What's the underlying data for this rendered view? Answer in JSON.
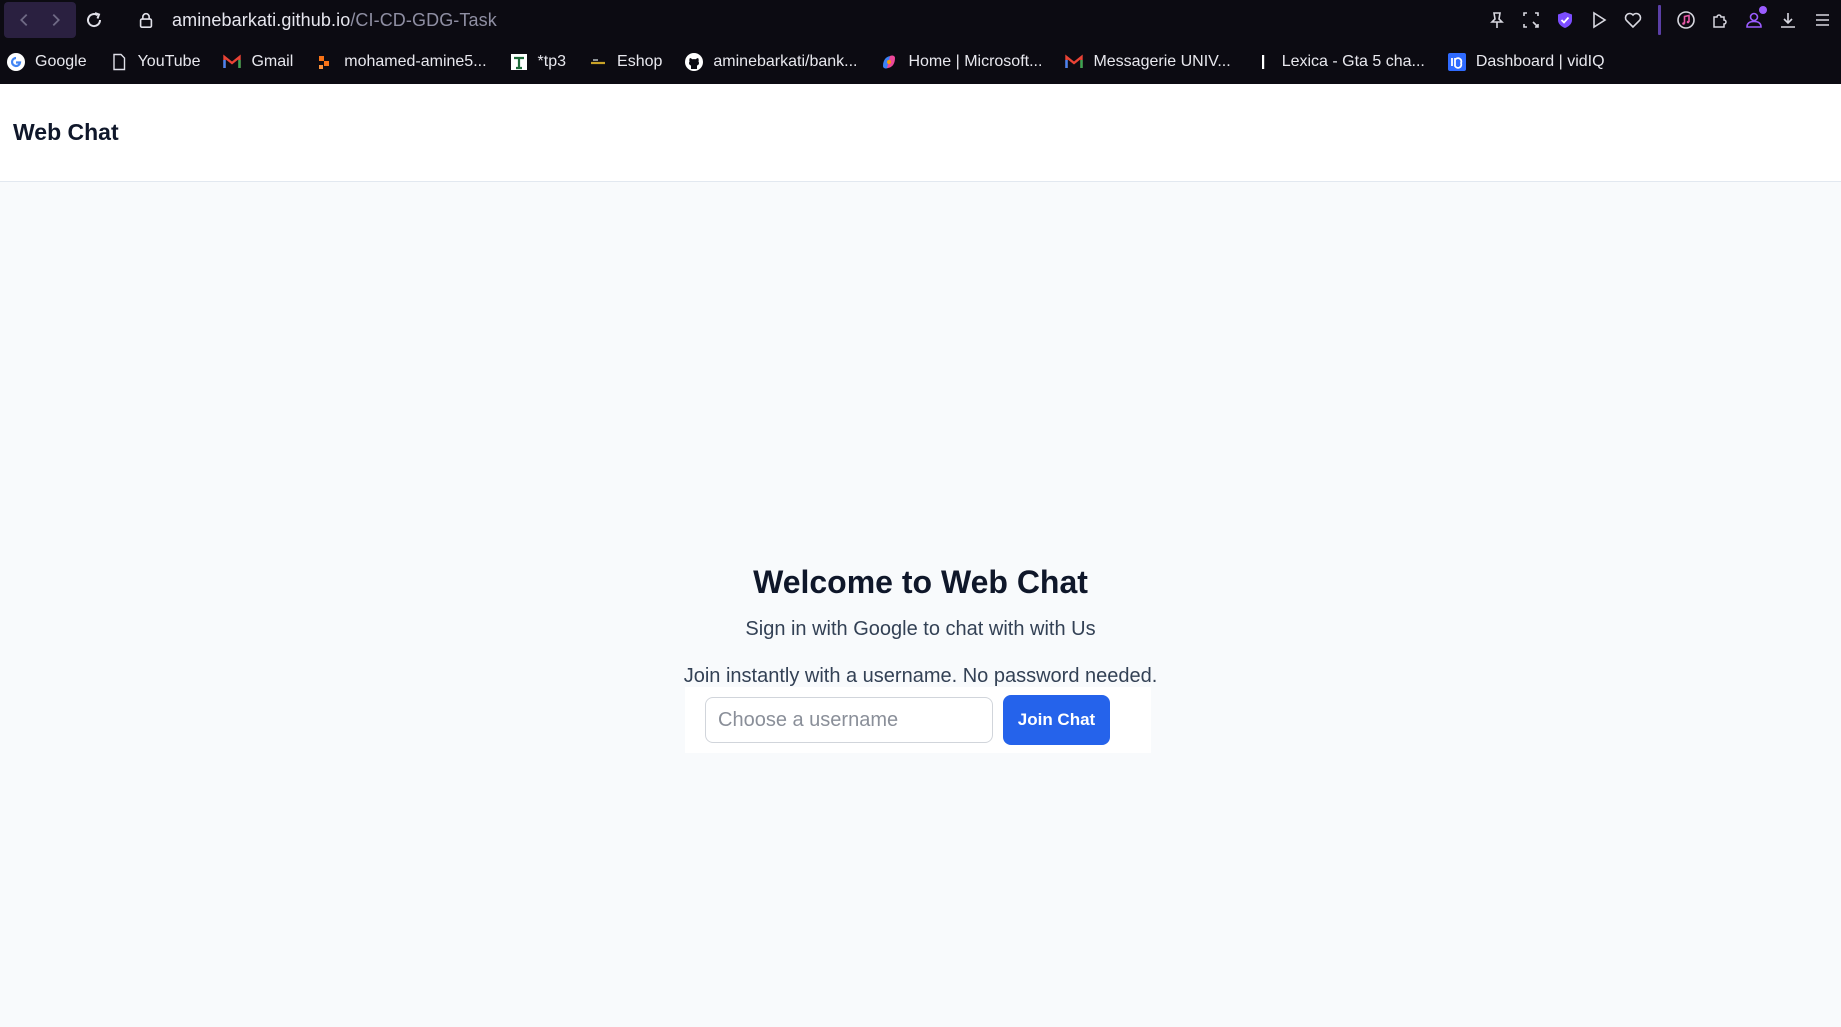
{
  "browser": {
    "url": {
      "host": "aminebarkati.github.io",
      "path": "/CI-CD-GDG-Task"
    },
    "bookmarks": [
      {
        "label": "Google",
        "icon": "google-icon"
      },
      {
        "label": "YouTube",
        "icon": "page-icon"
      },
      {
        "label": "Gmail",
        "icon": "gmail-icon"
      },
      {
        "label": "mohamed-amine5...",
        "icon": "app-icon"
      },
      {
        "label": "*tp3",
        "icon": "tp3-icon"
      },
      {
        "label": "Eshop",
        "icon": "eshop-icon"
      },
      {
        "label": "aminebarkati/bank...",
        "icon": "github-icon"
      },
      {
        "label": "Home | Microsoft...",
        "icon": "copilot-icon"
      },
      {
        "label": "Messagerie UNIV...",
        "icon": "gmail-icon"
      },
      {
        "label": "Lexica - Gta 5 cha...",
        "icon": "lexica-icon"
      },
      {
        "label": "Dashboard | vidIQ",
        "icon": "vidiq-icon"
      }
    ]
  },
  "app": {
    "brand": "Web Chat",
    "welcome_title": "Welcome to Web Chat",
    "subtitle_google": "Sign in with Google to chat with with Us",
    "subtitle_username": "Join instantly with a username. No password needed.",
    "username_placeholder": "Choose a username",
    "username_value": "",
    "join_button": "Join Chat"
  },
  "colors": {
    "accent": "#2563eb",
    "chrome_bg": "#0c0b12",
    "page_bg": "#f8fafc"
  }
}
